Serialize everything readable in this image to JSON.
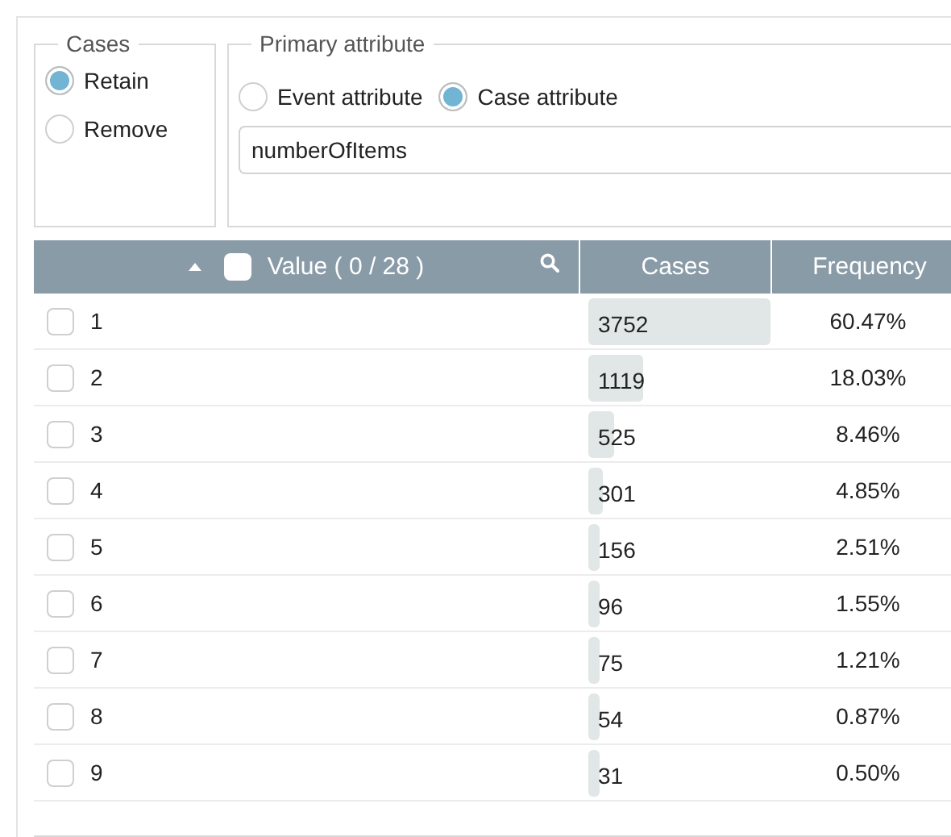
{
  "cases_group": {
    "legend": "Cases",
    "options": [
      {
        "label": "Retain",
        "selected": true
      },
      {
        "label": "Remove",
        "selected": false
      }
    ]
  },
  "primary_attribute": {
    "legend": "Primary attribute",
    "options": [
      {
        "label": "Event attribute",
        "selected": false
      },
      {
        "label": "Case attribute",
        "selected": true
      }
    ],
    "value": "numberOfItems"
  },
  "table": {
    "header_checked": false,
    "columns": [
      "Value ( 0 / 28 )",
      "Cases",
      "Frequency"
    ],
    "rows": [
      {
        "value": "1",
        "checked": false,
        "cases": "3752",
        "frequency": "60.47%"
      },
      {
        "value": "2",
        "checked": false,
        "cases": "1119",
        "frequency": "18.03%"
      },
      {
        "value": "3",
        "checked": false,
        "cases": "525",
        "frequency": "8.46%"
      },
      {
        "value": "4",
        "checked": false,
        "cases": "301",
        "frequency": "4.85%"
      },
      {
        "value": "5",
        "checked": false,
        "cases": "156",
        "frequency": "2.51%"
      },
      {
        "value": "6",
        "checked": false,
        "cases": "96",
        "frequency": "1.55%"
      },
      {
        "value": "7",
        "checked": false,
        "cases": "75",
        "frequency": "1.21%"
      },
      {
        "value": "8",
        "checked": false,
        "cases": "54",
        "frequency": "0.87%"
      },
      {
        "value": "9",
        "checked": false,
        "cases": "31",
        "frequency": "0.50%"
      }
    ]
  }
}
